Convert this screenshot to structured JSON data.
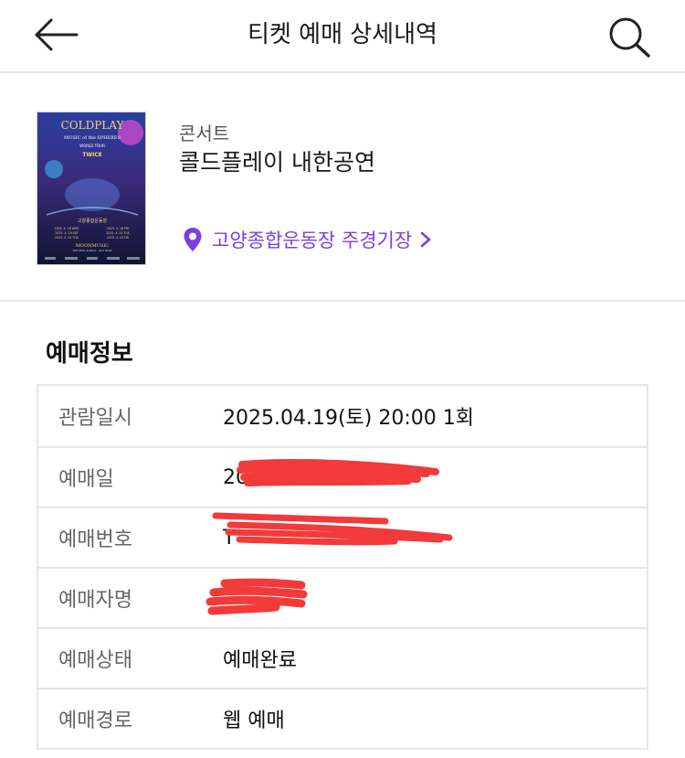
{
  "header": {
    "title": "티켓 예매 상세내역"
  },
  "event": {
    "category": "콘서트",
    "title": "콜드플레이 내한공연",
    "venue": "고양종합운동장 주경기장"
  },
  "poster": {
    "band": "COLDPLAY",
    "tour": "MUSIC of the SPHERES",
    "subtitle": "WORLD TOUR",
    "guest": "TWICE",
    "venue": "고양종합운동장",
    "dates": [
      "2025. 4. 16 WED",
      "2025. 4. 18 FRI",
      "2025. 4. 19 SAT",
      "2025. 4. 22 TUE",
      "2025. 4. 24 THU",
      "2025. 4. 25 FRI"
    ],
    "album": "MOONMUSIC",
    "tagline": "THE NEW ALBUM - OUT NOW"
  },
  "booking": {
    "section_title": "예매정보",
    "rows": [
      {
        "label": "관람일시",
        "value": "2025.04.19(토) 20:00 1회"
      },
      {
        "label": "예매일",
        "value": "20"
      },
      {
        "label": "예매번호",
        "value": "T"
      },
      {
        "label": "예매자명",
        "value": ""
      },
      {
        "label": "예매상태",
        "value": "예매완료"
      },
      {
        "label": "예매경로",
        "value": "웹 예매"
      }
    ]
  },
  "colors": {
    "accent": "#7a3fe0",
    "redaction": "#f23a3a",
    "divider": "#e6e6e6"
  },
  "icons": {
    "back": "arrow-left-icon",
    "search": "search-icon",
    "venue": "location-pin-icon",
    "chevron": "chevron-right-icon"
  }
}
